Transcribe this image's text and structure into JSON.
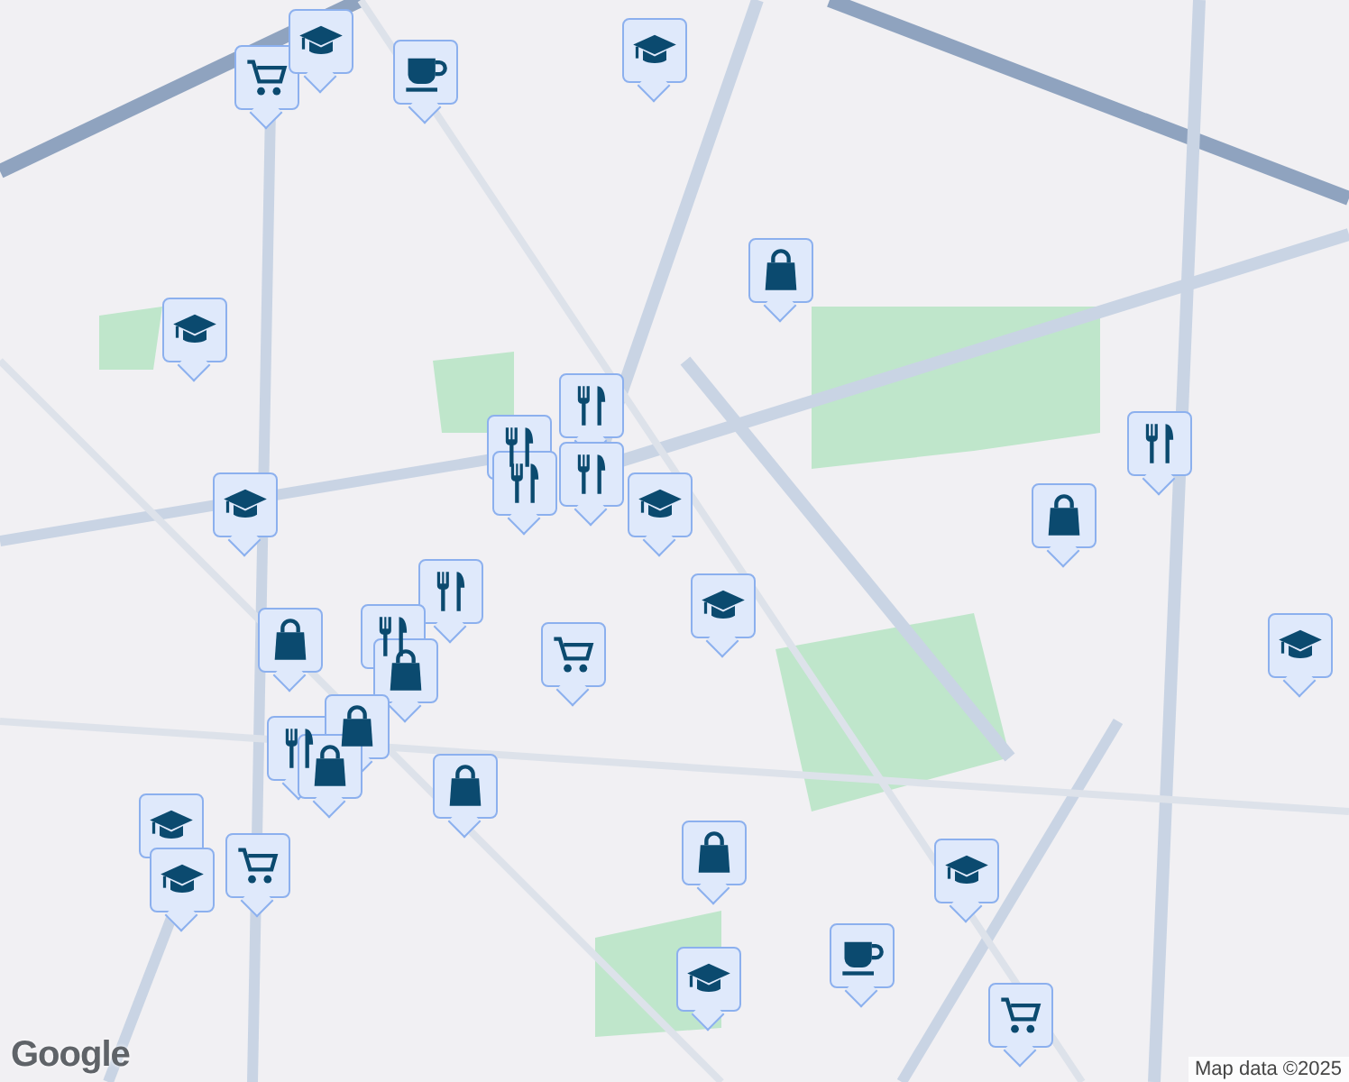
{
  "map": {
    "pins": [
      {
        "kind": "grocery"
      },
      {
        "kind": "school"
      },
      {
        "kind": "cafe"
      },
      {
        "kind": "school"
      },
      {
        "kind": "shopping"
      },
      {
        "kind": "school"
      },
      {
        "kind": "restaurant"
      },
      {
        "kind": "restaurant"
      },
      {
        "kind": "restaurant"
      },
      {
        "kind": "restaurant"
      },
      {
        "kind": "school"
      },
      {
        "kind": "school"
      },
      {
        "kind": "shopping"
      },
      {
        "kind": "restaurant"
      },
      {
        "kind": "restaurant"
      },
      {
        "kind": "restaurant"
      },
      {
        "kind": "shopping"
      },
      {
        "kind": "shopping"
      },
      {
        "kind": "grocery"
      },
      {
        "kind": "school"
      },
      {
        "kind": "school"
      },
      {
        "kind": "restaurant"
      },
      {
        "kind": "shopping"
      },
      {
        "kind": "shopping"
      },
      {
        "kind": "shopping"
      },
      {
        "kind": "school"
      },
      {
        "kind": "school"
      },
      {
        "kind": "grocery"
      },
      {
        "kind": "shopping"
      },
      {
        "kind": "school"
      },
      {
        "kind": "cafe"
      },
      {
        "kind": "school"
      },
      {
        "kind": "grocery"
      }
    ],
    "logo": "Google",
    "attribution": "Map data ©2025"
  }
}
